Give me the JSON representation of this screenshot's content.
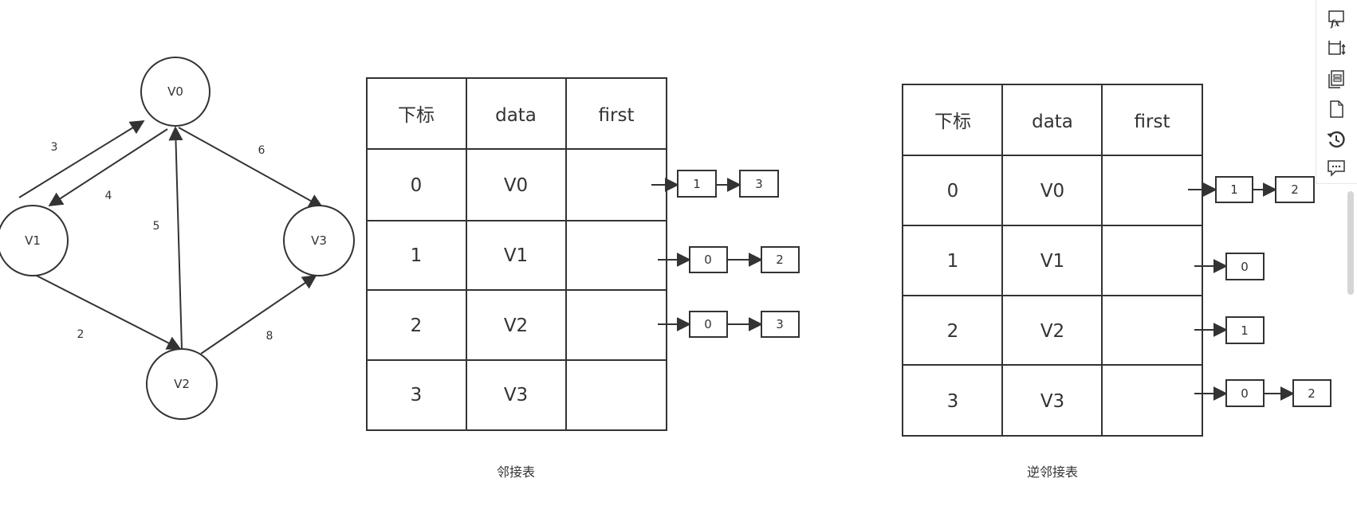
{
  "graph": {
    "nodes": [
      {
        "id": "v0",
        "label": "V0"
      },
      {
        "id": "v1",
        "label": "V1"
      },
      {
        "id": "v2",
        "label": "V2"
      },
      {
        "id": "v3",
        "label": "V3"
      }
    ],
    "edge_labels": [
      "3",
      "4",
      "5",
      "6",
      "2",
      "8"
    ]
  },
  "adjacency_table": {
    "caption": "邻接表",
    "headers": [
      "下标",
      "data",
      "first"
    ],
    "rows": [
      {
        "index": "0",
        "data": "V0",
        "list": [
          "1",
          "3"
        ]
      },
      {
        "index": "1",
        "data": "V1",
        "list": [
          "0",
          "2"
        ]
      },
      {
        "index": "2",
        "data": "V2",
        "list": [
          "0",
          "3"
        ]
      },
      {
        "index": "3",
        "data": "V3",
        "list": []
      }
    ]
  },
  "inverse_table": {
    "caption": "逆邻接表",
    "headers": [
      "下标",
      "data",
      "first"
    ],
    "rows": [
      {
        "index": "0",
        "data": "V0",
        "list": [
          "1",
          "2"
        ]
      },
      {
        "index": "1",
        "data": "V1",
        "list": [
          "0"
        ]
      },
      {
        "index": "2",
        "data": "V2",
        "list": [
          "1"
        ]
      },
      {
        "index": "3",
        "data": "V3",
        "list": [
          "0",
          "2"
        ]
      }
    ]
  },
  "toolbar": {
    "icons": [
      "formula-icon",
      "crop-icon",
      "pages-icon",
      "document-icon",
      "history-icon",
      "comment-icon"
    ]
  }
}
